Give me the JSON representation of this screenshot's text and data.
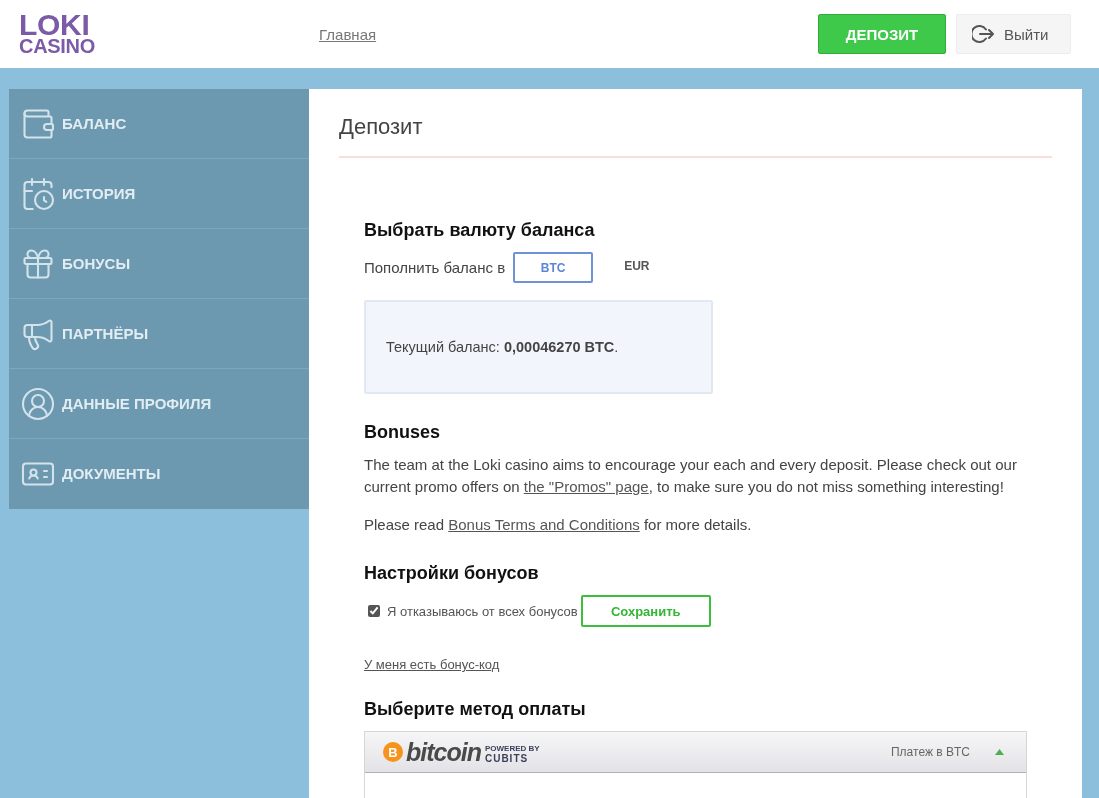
{
  "header": {
    "logo": [
      "LOKI",
      "CASINO"
    ],
    "nav_link": "Главная",
    "deposit_button": "ДЕПОЗИТ",
    "logout_button": "Выйти"
  },
  "sidebar": {
    "items": [
      {
        "label": "БАЛАНС",
        "selected": false
      },
      {
        "label": "ИСТОРИЯ",
        "selected": false
      },
      {
        "label": "БОНУСЫ",
        "selected": false
      },
      {
        "label": "ПАРТНЁРЫ",
        "selected": false
      },
      {
        "label": "ДАННЫЕ ПРОФИЛЯ",
        "selected": false
      },
      {
        "label": "ДОКУМЕНТЫ",
        "selected": false
      }
    ]
  },
  "main": {
    "title": "Депозит",
    "currency": {
      "heading": "Выбрать валюту баланса",
      "label": "Пополнить баланс в",
      "options": [
        {
          "label": "BTC",
          "selected": true
        },
        {
          "label": "EUR",
          "selected": false
        }
      ],
      "balance": "Текущий баланс: **0,00046270 BTC**."
    },
    "bonuses": {
      "heading": "Bonuses",
      "paragraphs": [
        [
          {
            "kind": "text",
            "text": "The team at the Loki casino aims to encourage your each and every deposit. Please check out our current promo offers on "
          },
          {
            "kind": "link",
            "text": "the \"Promos\" page"
          },
          {
            "kind": "text",
            "text": ", to make sure you do not miss something interesting!"
          }
        ],
        [
          {
            "kind": "text",
            "text": "Please read "
          },
          {
            "kind": "link",
            "text": "Bonus Terms and Conditions"
          },
          {
            "kind": "text",
            "text": " for more details."
          }
        ]
      ]
    },
    "bonus_settings": {
      "heading": "Настройки бонусов",
      "checkbox": {
        "label": "Я отказываюсь от всех бонусов",
        "checked": true
      },
      "save_button": "Сохранить",
      "bonus_code_link": "У меня есть бонус-код"
    },
    "payment": {
      "heading": "Выберите метод оплаты",
      "methods": [
        {
          "coin_symbol": "B",
          "name": "bitcoin",
          "powered_by": "POWERED BY",
          "provider": "CUBITS",
          "caption": "Платеж в BTC",
          "expanded": true
        }
      ]
    }
  }
}
